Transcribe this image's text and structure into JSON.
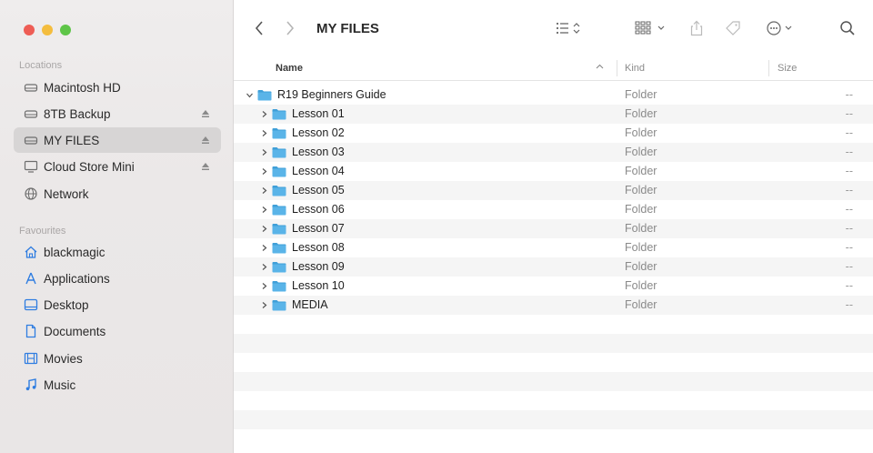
{
  "sidebar": {
    "locations_title": "Locations",
    "favourites_title": "Favourites",
    "locations": [
      {
        "label": "Macintosh HD",
        "icon": "drive-icon",
        "eject": false
      },
      {
        "label": "8TB Backup",
        "icon": "drive-icon",
        "eject": true
      },
      {
        "label": "MY FILES",
        "icon": "drive-icon",
        "eject": true,
        "selected": true
      },
      {
        "label": "Cloud Store Mini",
        "icon": "display-icon",
        "eject": true
      },
      {
        "label": "Network",
        "icon": "globe-icon",
        "eject": false
      }
    ],
    "favourites": [
      {
        "label": "blackmagic",
        "icon": "home-icon"
      },
      {
        "label": "Applications",
        "icon": "applications-icon"
      },
      {
        "label": "Desktop",
        "icon": "desktop-icon"
      },
      {
        "label": "Documents",
        "icon": "document-icon"
      },
      {
        "label": "Movies",
        "icon": "film-icon"
      },
      {
        "label": "Music",
        "icon": "music-icon"
      }
    ]
  },
  "toolbar": {
    "title": "MY FILES",
    "icons": [
      "chevron-left-icon",
      "chevron-right-icon",
      "list-view-icon",
      "grid-view-icon",
      "share-icon",
      "tag-icon",
      "more-icon",
      "search-icon"
    ]
  },
  "columns": {
    "name": "Name",
    "kind": "Kind",
    "size": "Size"
  },
  "rows": [
    {
      "name": "R19 Beginners Guide",
      "kind": "Folder",
      "size": "--",
      "expanded": true,
      "level": 0
    },
    {
      "name": "Lesson 01",
      "kind": "Folder",
      "size": "--",
      "expanded": false,
      "level": 1
    },
    {
      "name": "Lesson 02",
      "kind": "Folder",
      "size": "--",
      "expanded": false,
      "level": 1
    },
    {
      "name": "Lesson 03",
      "kind": "Folder",
      "size": "--",
      "expanded": false,
      "level": 1
    },
    {
      "name": "Lesson 04",
      "kind": "Folder",
      "size": "--",
      "expanded": false,
      "level": 1
    },
    {
      "name": "Lesson 05",
      "kind": "Folder",
      "size": "--",
      "expanded": false,
      "level": 1
    },
    {
      "name": "Lesson 06",
      "kind": "Folder",
      "size": "--",
      "expanded": false,
      "level": 1
    },
    {
      "name": "Lesson 07",
      "kind": "Folder",
      "size": "--",
      "expanded": false,
      "level": 1
    },
    {
      "name": "Lesson 08",
      "kind": "Folder",
      "size": "--",
      "expanded": false,
      "level": 1
    },
    {
      "name": "Lesson 09",
      "kind": "Folder",
      "size": "--",
      "expanded": false,
      "level": 1
    },
    {
      "name": "Lesson 10",
      "kind": "Folder",
      "size": "--",
      "expanded": false,
      "level": 1
    },
    {
      "name": "MEDIA",
      "kind": "Folder",
      "size": "--",
      "expanded": false,
      "level": 1
    }
  ],
  "colors": {
    "folder": "#5ab4e8",
    "folder_tab": "#3f9fd8",
    "selection": "#d7d5d5"
  }
}
